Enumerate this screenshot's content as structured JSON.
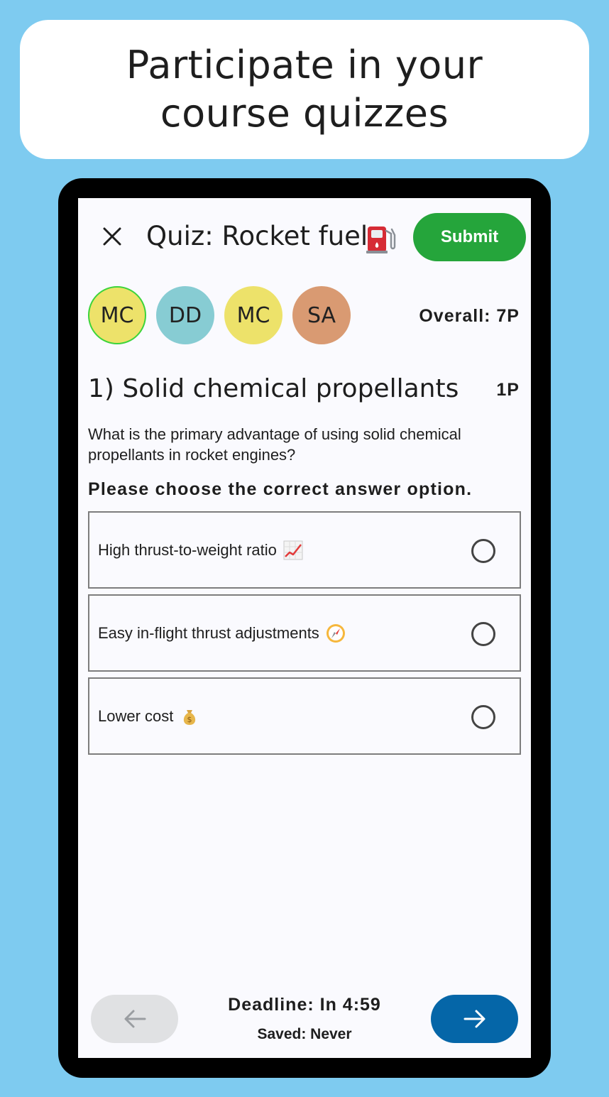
{
  "banner": {
    "text": "Participate in your course quizzes"
  },
  "header": {
    "close_icon": "close-icon",
    "title": "Quiz: Rocket fuels",
    "title_icon": "fuel-pump-icon",
    "submit_label": "Submit",
    "submit_color": "#25a53b"
  },
  "participants": [
    {
      "initials": "MC",
      "color": "#ede26a",
      "active": true,
      "active_ring": "#3bd43b"
    },
    {
      "initials": "DD",
      "color": "#87ccd3",
      "active": false
    },
    {
      "initials": "MC",
      "color": "#ede26a",
      "active": false
    },
    {
      "initials": "SA",
      "color": "#d99a72",
      "active": false
    }
  ],
  "overall": "Overall: 7P",
  "question": {
    "title": "1) Solid chemical propellants",
    "points": "1P",
    "text": "What is the primary advantage of using solid chemical propellants in rocket engines?",
    "instruction": "Please choose the correct answer option.",
    "options": [
      {
        "label": "High thrust-to-weight ratio",
        "icon": "chart-increasing-icon",
        "selected": false
      },
      {
        "label": "Easy in-flight thrust adjustments",
        "icon": "compass-icon",
        "selected": false
      },
      {
        "label": "Lower cost",
        "icon": "money-bag-icon",
        "selected": false
      }
    ]
  },
  "footer": {
    "prev_icon": "arrow-left-icon",
    "next_icon": "arrow-right-icon",
    "deadline": "Deadline: In 4:59",
    "saved": "Saved: Never",
    "next_color": "#0566a8"
  }
}
